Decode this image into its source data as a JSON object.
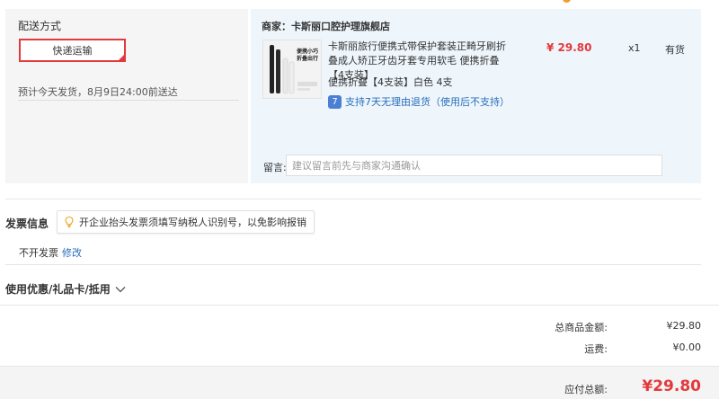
{
  "shipping": {
    "title": "配送方式",
    "method_label": "快递运输",
    "estimate": "预计今天发货，8月9日24:00前送达"
  },
  "order": {
    "merchant": "商家：卡斯丽口腔护理旗舰店",
    "product": {
      "title": "卡斯丽旅行便携式带保护套装正畸牙刷折叠成人矫正牙齿牙套专用软毛 便携折叠【4支装】",
      "spec": "便携折叠【4支装】白色 4支",
      "return_policy": "支持7天无理由退货（使用后不支持）",
      "return_icon_char": "7",
      "image_text_line1": "便携小巧",
      "image_text_line2": "折叠出行",
      "price": "¥ 29.80",
      "qty": "x1",
      "stock": "有货"
    },
    "remark_label": "留言:",
    "remark_placeholder": "建议留言前先与商家沟通确认"
  },
  "invoice": {
    "title": "发票信息",
    "tip": "开企业抬头发票须填写纳税人识别号，以免影响报销",
    "status": "不开发票",
    "edit_label": "修改"
  },
  "coupon": {
    "label": "使用优惠/礼品卡/抵用"
  },
  "summary": {
    "items_total_label": "总商品金额:",
    "items_total_value": "¥29.80",
    "shipping_fee_label": "运费:",
    "shipping_fee_value": "¥0.00",
    "payable_label": "应付总额:",
    "payable_value": "¥29.80"
  },
  "colors": {
    "accent_red": "#e4393c",
    "link_blue": "#2a6ebb",
    "panel_blue": "#eef6fc",
    "panel_gray": "#f5f5f5"
  },
  "icons": {
    "bulb": "lightbulb-icon",
    "chevron": "chevron-down-icon",
    "return": "seven-day-return-icon",
    "selected": "check-corner-icon"
  }
}
